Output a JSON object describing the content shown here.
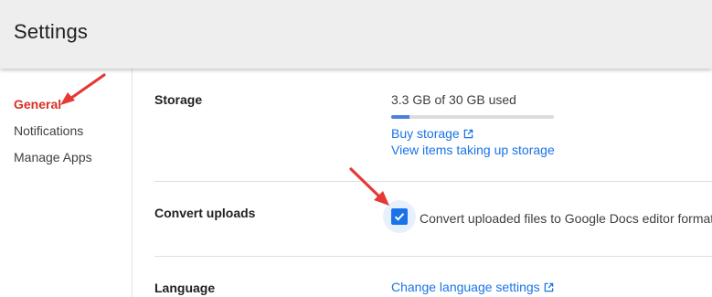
{
  "header": {
    "title": "Settings"
  },
  "sidebar": {
    "items": [
      {
        "label": "General",
        "active": true
      },
      {
        "label": "Notifications",
        "active": false
      },
      {
        "label": "Manage Apps",
        "active": false
      }
    ]
  },
  "storage": {
    "label": "Storage",
    "used_text": "3.3 GB of 30 GB used",
    "used_fraction": 0.11,
    "buy_link": "Buy storage",
    "view_link": "View items taking up storage"
  },
  "convert": {
    "label": "Convert uploads",
    "checkbox_text": "Convert uploaded files to Google Docs editor format",
    "checked": true
  },
  "language": {
    "label": "Language",
    "link": "Change language settings"
  },
  "colors": {
    "accent": "#1a73e8",
    "active_nav": "#d93025",
    "annotation_arrow": "#e53935"
  }
}
